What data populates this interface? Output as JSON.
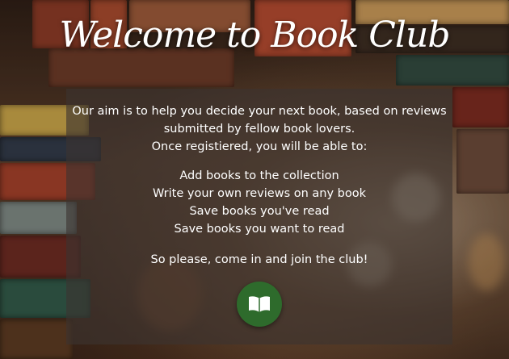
{
  "page": {
    "title": "Welcome to Book Club"
  },
  "panel": {
    "intro_lines": [
      "Our aim is to help you decide your next book, based on reviews",
      "submitted by fellow book lovers.",
      "Once registiered, you will be able to:"
    ],
    "features": [
      "Add books to the collection",
      "Write your own reviews on any book",
      "Save books you've read",
      "Save books you want to read"
    ],
    "closing": "So please, come in and join the club!",
    "join_button": {
      "icon": "open-book-icon",
      "color": "#2e6b2c"
    }
  },
  "colors": {
    "text": "#ffffff",
    "panel_overlay": "rgba(60,52,48,0.62)",
    "button": "#2e6b2c"
  }
}
